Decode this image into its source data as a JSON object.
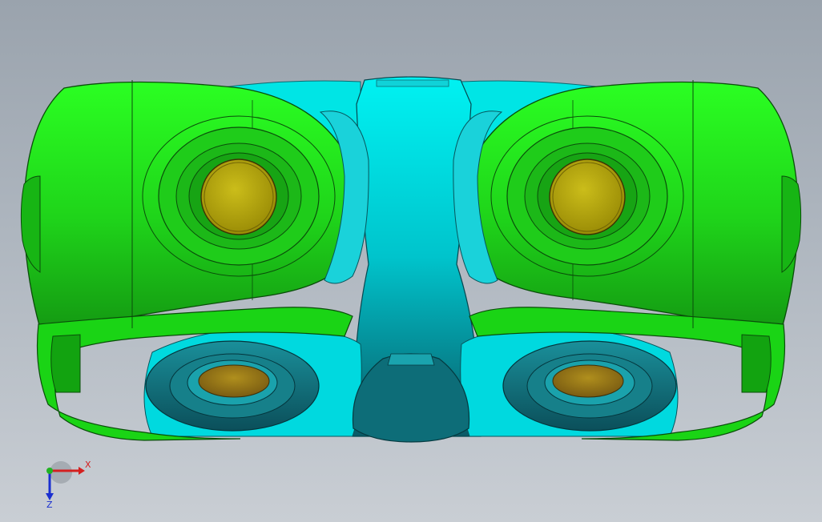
{
  "viewport": {
    "background_top": "#9aa3ad",
    "background_bottom": "#c9ced4"
  },
  "model": {
    "parts": [
      {
        "name": "left-yoke",
        "color": "#22e01c"
      },
      {
        "name": "right-yoke",
        "color": "#22e01c"
      },
      {
        "name": "center-cross",
        "color": "#00e8e8"
      },
      {
        "name": "pin",
        "color": "#b8aa10"
      }
    ]
  },
  "triad": {
    "x_label": "X",
    "z_label": "Z",
    "x_color": "#d42020",
    "z_color": "#1a2fd0",
    "y_color": "#21b321"
  }
}
